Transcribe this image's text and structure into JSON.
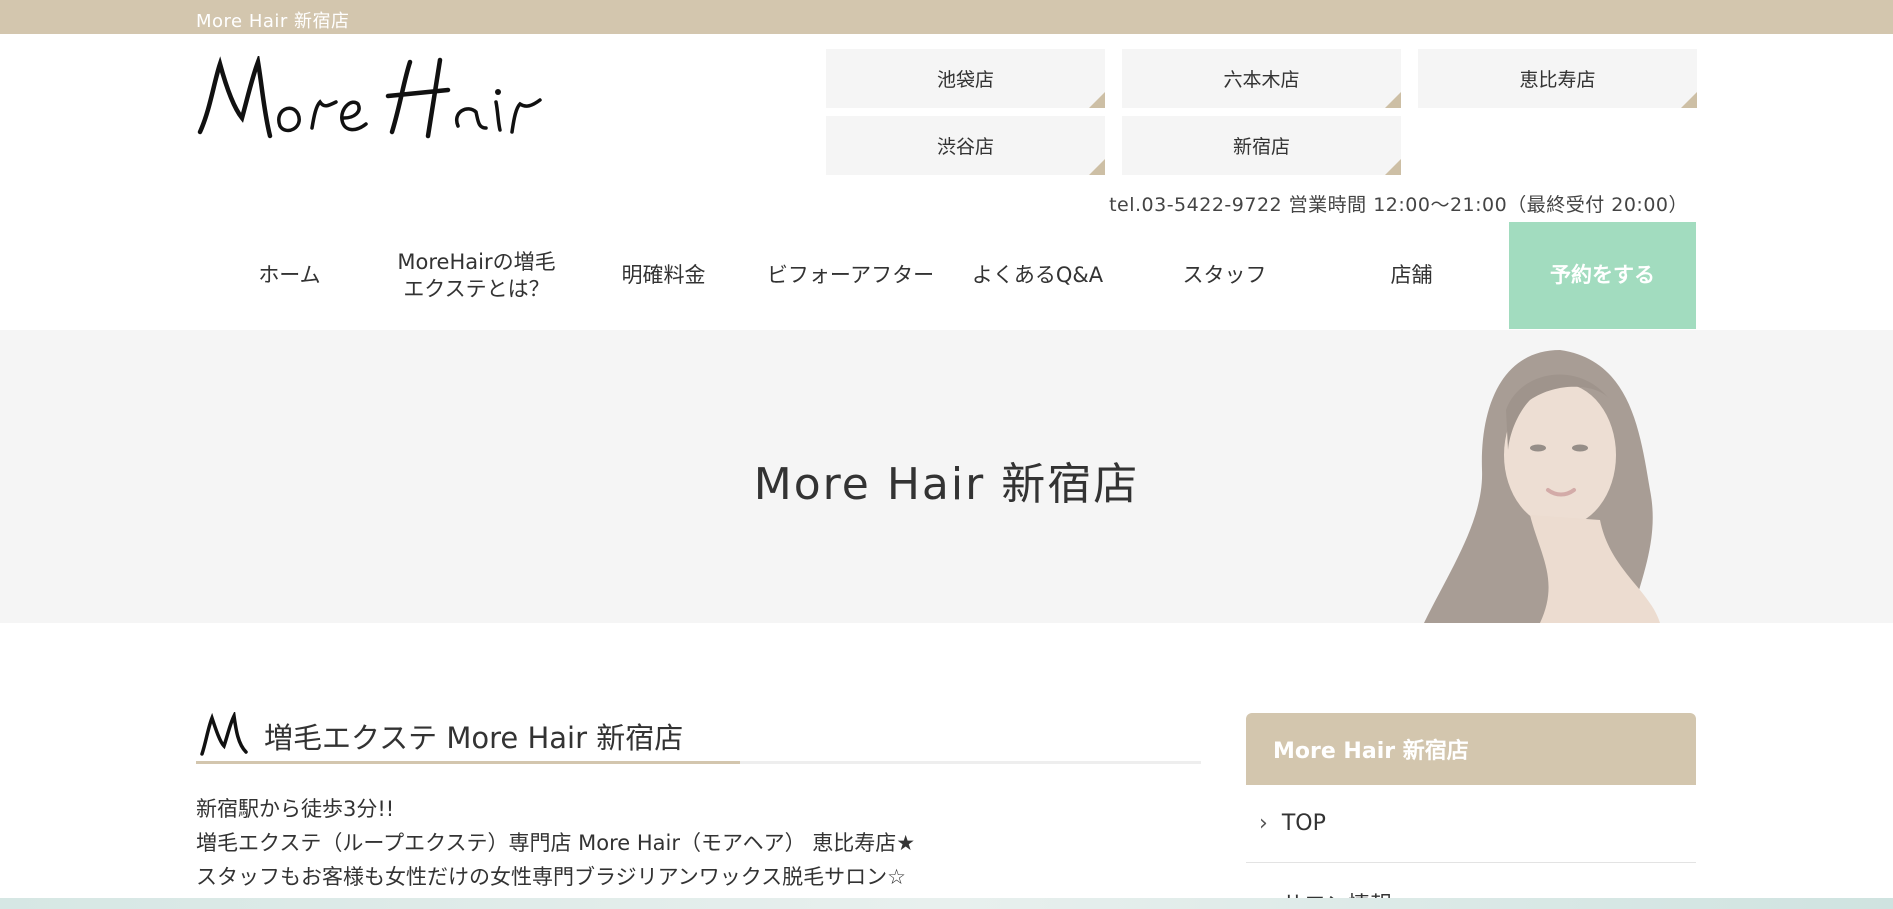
{
  "topbar": {
    "text": "More Hair 新宿店"
  },
  "logo": {
    "alt": "More Hair"
  },
  "stores": [
    {
      "label": "池袋店"
    },
    {
      "label": "六本木店"
    },
    {
      "label": "恵比寿店"
    },
    {
      "label": "渋谷店"
    },
    {
      "label": "新宿店"
    }
  ],
  "tel": "tel.03-5422-9722 営業時間 12:00～21:00（最終受付 20:00）",
  "nav": [
    {
      "label": "ホーム"
    },
    {
      "label": "MoreHairの増毛\nエクステとは？"
    },
    {
      "label": "明確料金"
    },
    {
      "label": "ビフォーアフター"
    },
    {
      "label": "よくあるQ&A"
    },
    {
      "label": "スタッフ"
    },
    {
      "label": "店舗"
    },
    {
      "label": "予約をする"
    }
  ],
  "hero": {
    "title": "More Hair 新宿店"
  },
  "main": {
    "title": "増毛エクステ More Hair 新宿店",
    "lines": [
      "新宿駅から徒歩3分!!",
      "増毛エクステ（ループエクステ）専門店 More Hair（モアヘア） 恵比寿店★",
      "スタッフもお客様も女性だけの女性専門ブラジリアンワックス脱毛サロン☆"
    ]
  },
  "sidebar": {
    "title": "More Hair 新宿店",
    "items": [
      {
        "label": "TOP"
      },
      {
        "label": "サロン情報"
      }
    ]
  },
  "colors": {
    "beige": "#d3c6ae",
    "mint": "#a2dcbf",
    "panel": "#f5f5f5"
  }
}
